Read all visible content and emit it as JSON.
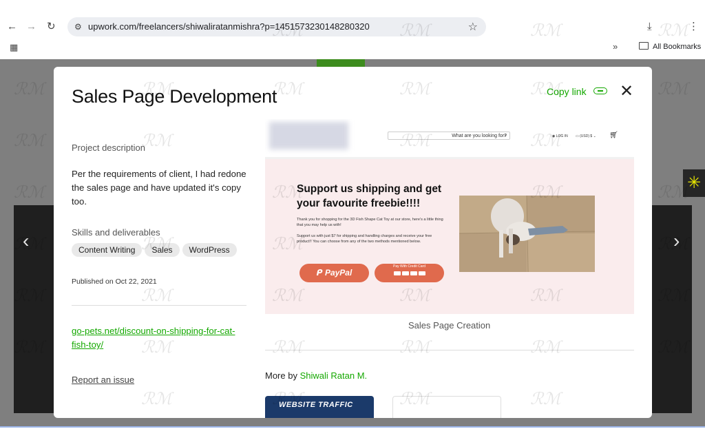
{
  "browser": {
    "url": "upwork.com/freelancers/shiwaliratanmishra?p=1451573230148280320",
    "bookmarks_label": "All Bookmarks"
  },
  "modal": {
    "title": "Sales Page Development",
    "copy_link_label": "Copy link",
    "description_label": "Project description",
    "description": "Per the requirements of client, I had redone the sales page and have updated it's copy too.",
    "skills_label": "Skills and deliverables",
    "skills": [
      "Content Writing",
      "Sales",
      "WordPress"
    ],
    "published": "Published on Oct 22, 2021",
    "project_link": "go-pets.net/discount-on-shipping-for-cat-fish-toy/",
    "report_label": "Report an issue",
    "image_caption": "Sales Page Creation",
    "more_by_prefix": "More by",
    "more_by_name": "Shiwali Ratan M."
  },
  "preview": {
    "search_placeholder": "What are you looking for?",
    "login": "LOG IN",
    "currency": "(USD) $",
    "headline": "Support us shipping and get your favourite freebie!!!!",
    "para1": "Thank you for shopping for the 3D Fish Shape Cat Toy at our store, here's a little thing that you may help us with!",
    "para2": "Support us with just $7 for shipping and handling charges and receive your free product!! You can choose from any of the two methods mentioned below.",
    "paypal": "PayPal",
    "credit_card": "Pay With Credit Card"
  },
  "thumbnail": {
    "label": "WEBSITE TRAFFIC"
  },
  "watermark": "RM",
  "colors": {
    "accent": "#14a800",
    "button": "#e06a4d",
    "backdrop": "#7f7f7f"
  }
}
